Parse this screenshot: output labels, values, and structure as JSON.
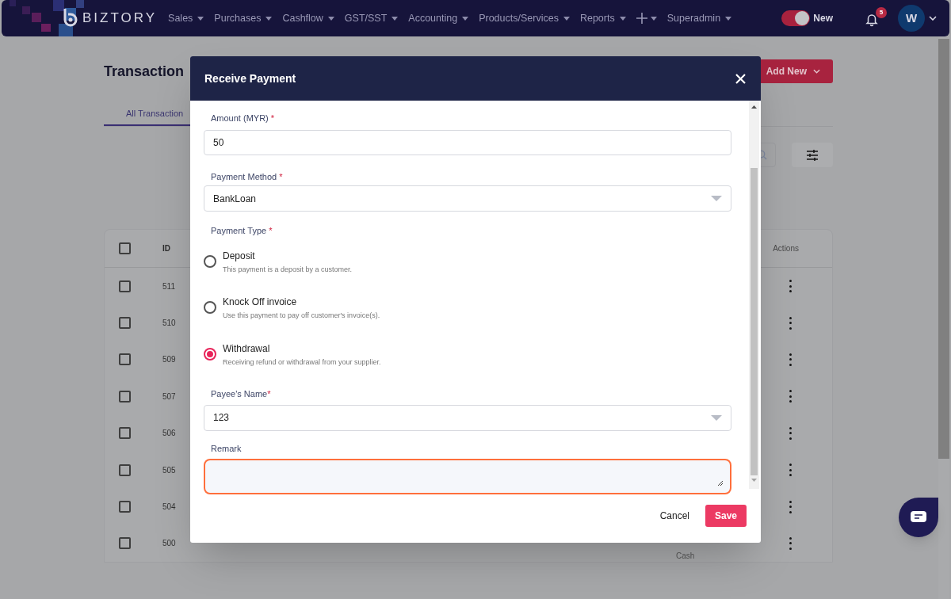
{
  "navbar": {
    "brand": "BIZTORY",
    "menu": [
      {
        "kind": "text",
        "label": "Sales"
      },
      {
        "kind": "text",
        "label": "Purchases"
      },
      {
        "kind": "text",
        "label": "Cashflow"
      },
      {
        "kind": "text",
        "label": "GST/SST"
      },
      {
        "kind": "text",
        "label": "Accounting"
      },
      {
        "kind": "text",
        "label": "Products/Services"
      },
      {
        "kind": "text",
        "label": "Reports"
      },
      {
        "kind": "plus"
      },
      {
        "kind": "text",
        "label": "Superadmin"
      }
    ],
    "toggle": {
      "label": "New",
      "on": true
    },
    "notification_count": "5",
    "avatar": "W"
  },
  "page": {
    "title": "Transaction",
    "add_button": "Add New",
    "tabs": [
      {
        "label": "All Transaction",
        "selected": true
      }
    ],
    "table": {
      "select_all_checked": false,
      "columns": {
        "id": "ID",
        "actions": "Actions"
      },
      "rows": [
        {
          "id": "511",
          "checked": false
        },
        {
          "id": "510",
          "checked": false
        },
        {
          "id": "509",
          "checked": false
        },
        {
          "id": "507",
          "checked": false
        },
        {
          "id": "506",
          "checked": false
        },
        {
          "id": "505",
          "checked": false
        },
        {
          "id": "504",
          "checked": false
        },
        {
          "id": "500",
          "checked": false,
          "column_7": "Cash"
        }
      ]
    }
  },
  "modal": {
    "title": "Receive Payment",
    "amount": {
      "label": "Amount (MYR)",
      "required_mark": "*",
      "value": "50"
    },
    "payment_method": {
      "label": "Payment Method",
      "required_mark": "*",
      "value": "BankLoan"
    },
    "payment_type": {
      "label": "Payment Type",
      "required_mark": "*",
      "options": [
        {
          "label": "Deposit",
          "description": "This payment is a deposit by a customer.",
          "selected": false
        },
        {
          "label": "Knock Off invoice",
          "description": "Use this payment to pay off customer's invoice(s).",
          "selected": false
        },
        {
          "label": "Withdrawal",
          "description": "Receiving refund or withdrawal from your supplier.",
          "selected": true
        }
      ]
    },
    "payee": {
      "label": "Payee's Name",
      "required_mark": "*",
      "value": "123"
    },
    "remark": {
      "label": "Remark",
      "focused": true
    },
    "buttons": {
      "cancel": "Cancel",
      "save": "Save"
    }
  }
}
